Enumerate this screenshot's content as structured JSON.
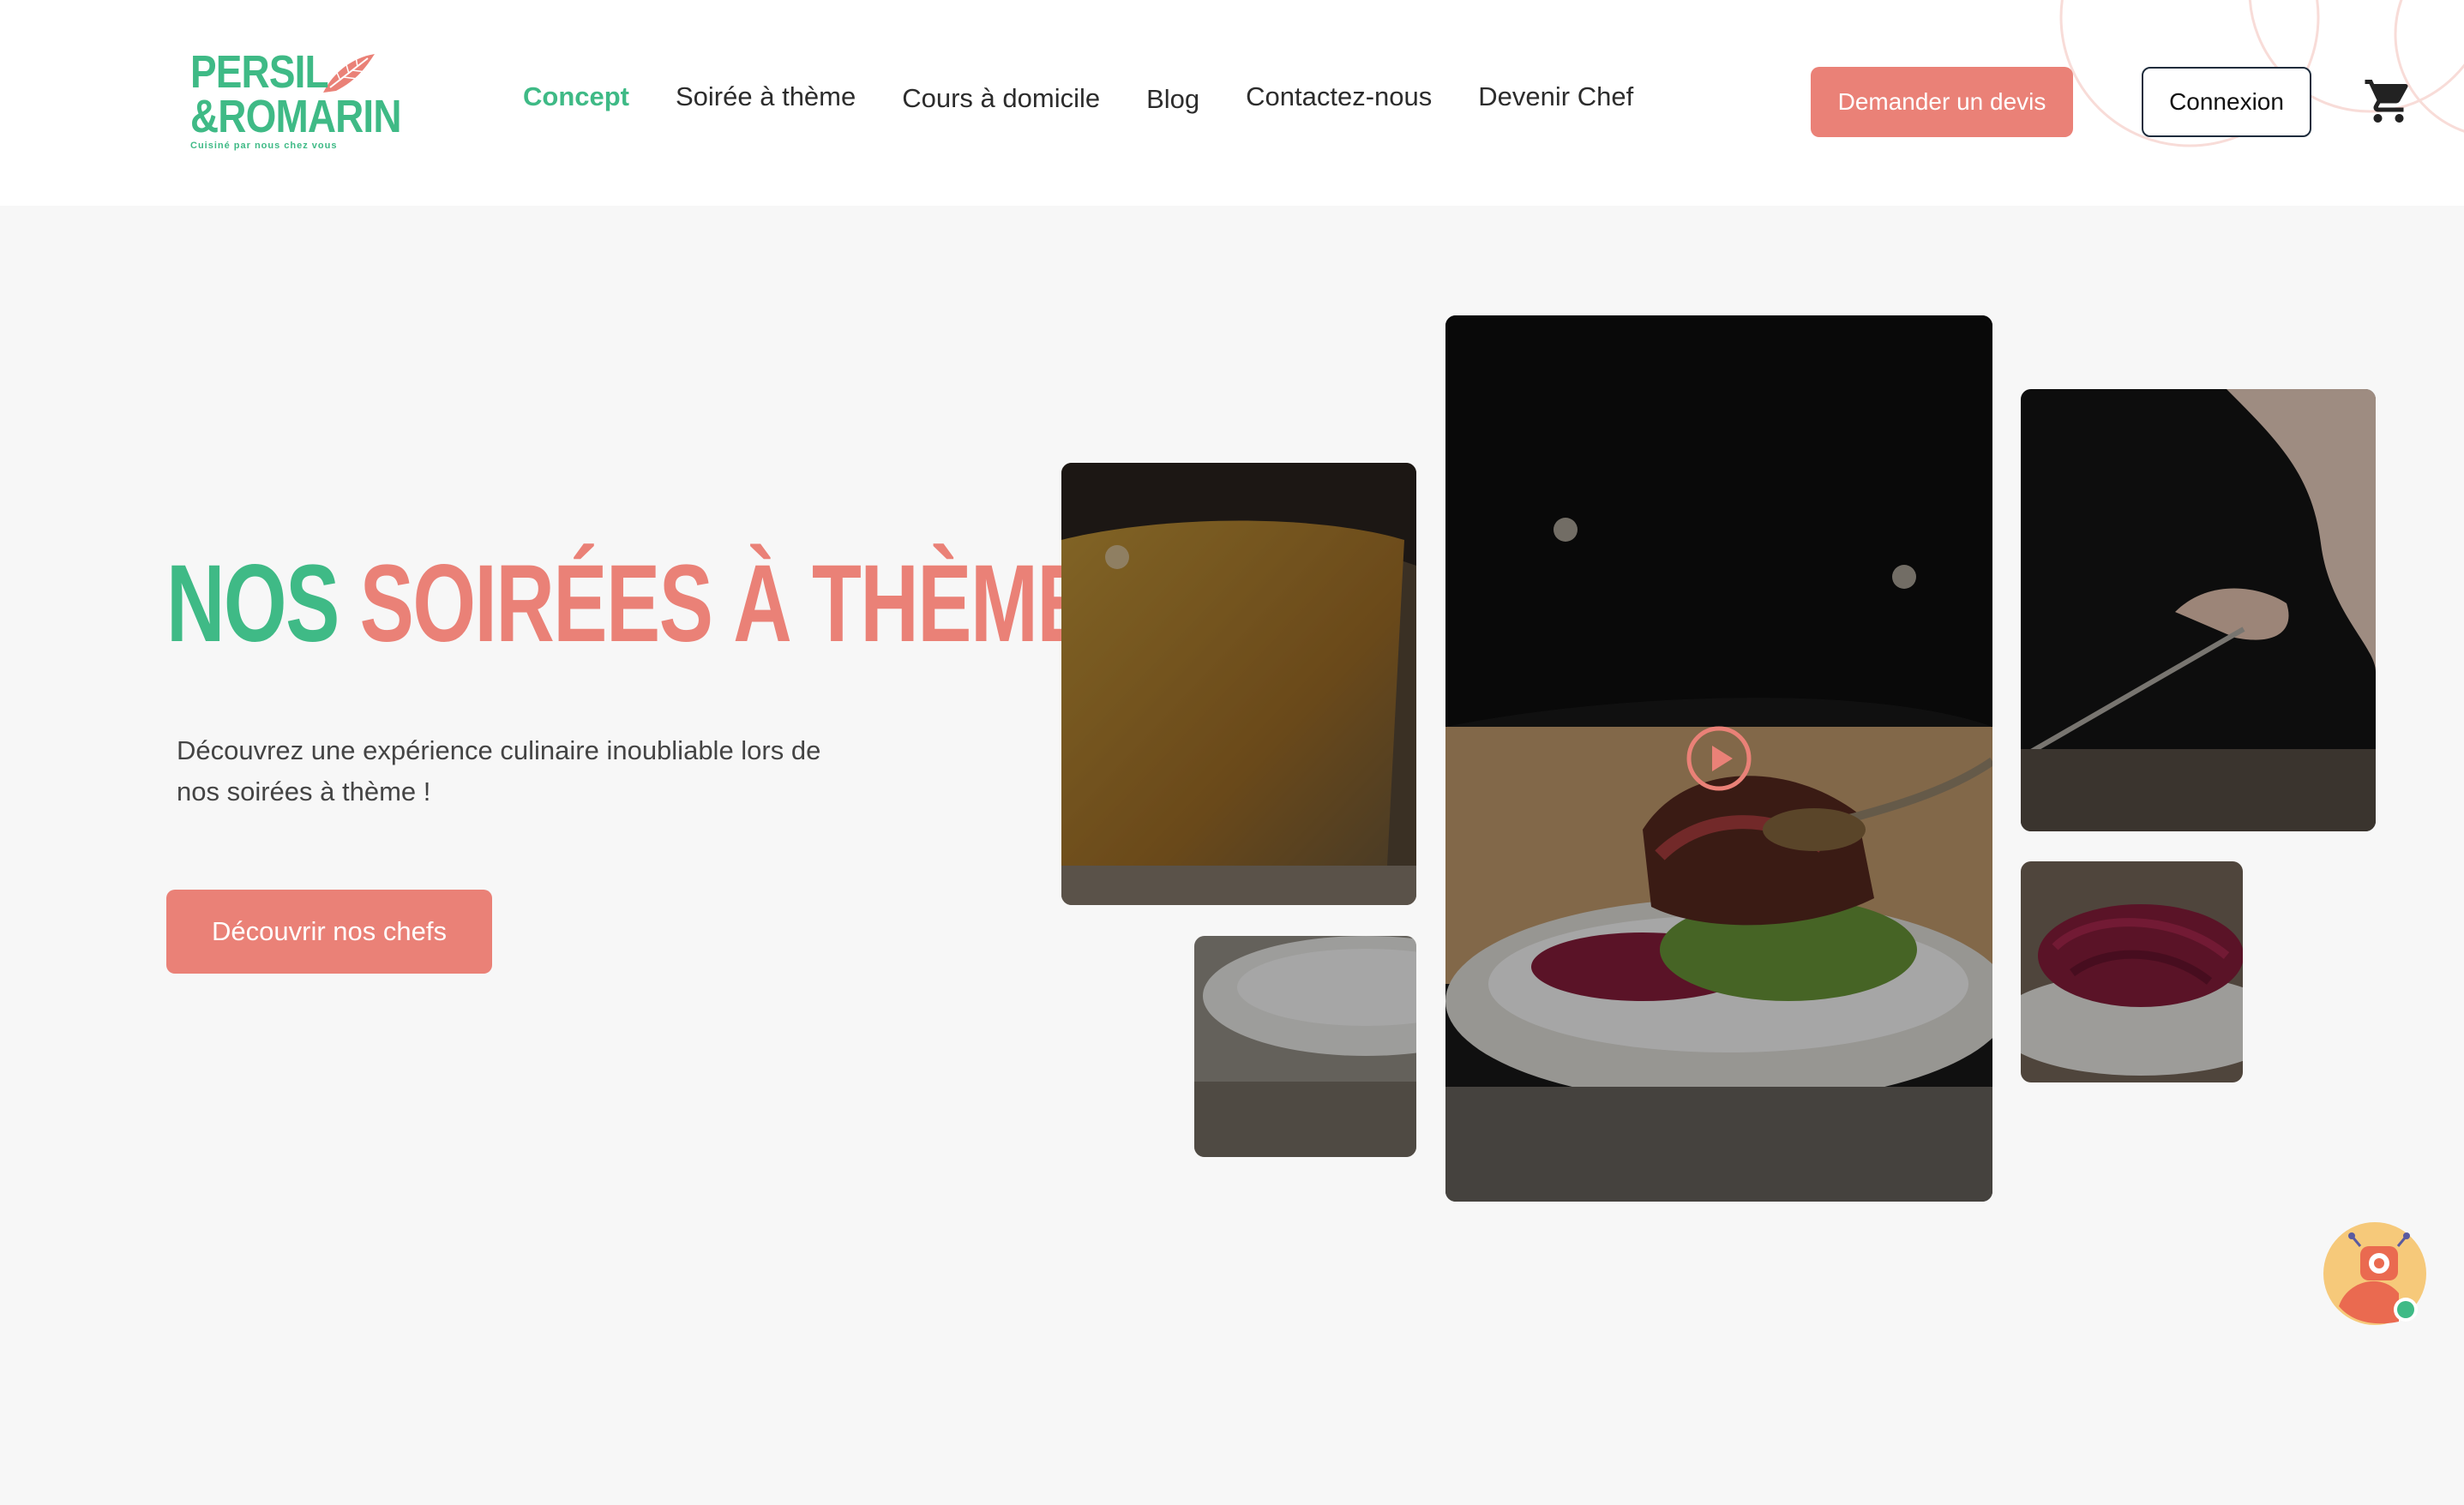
{
  "header": {
    "logo": {
      "line1": "PERSIL",
      "line2": "&ROMARIN",
      "tagline": "Cuisiné par nous chez vous"
    },
    "nav": [
      {
        "label": "Concept",
        "active": true
      },
      {
        "label": "Soirée à thème",
        "active": false
      },
      {
        "label": "Cours à domicile",
        "active": false
      },
      {
        "label": "Blog",
        "active": false
      },
      {
        "label": "Contactez-nous",
        "active": false
      },
      {
        "label": "Devenir Chef",
        "active": false
      }
    ],
    "quote_button": "Demander un devis",
    "login_button": "Connexion",
    "cart_icon": "cart-icon"
  },
  "hero": {
    "title_part1": "NOS",
    "title_part2": "SOIRÉES À THÈME",
    "description": "Découvrez une expérience culinaire inoubliable lors de nos soirées à thème !",
    "cta": "Découvrir nos chefs"
  },
  "gallery": {
    "play_icon": "play-icon"
  },
  "chat": {
    "icon": "robot-chat-icon"
  },
  "colors": {
    "brand_green": "#3fba86",
    "brand_pink": "#ea8177",
    "background": "#f7f7f7"
  }
}
